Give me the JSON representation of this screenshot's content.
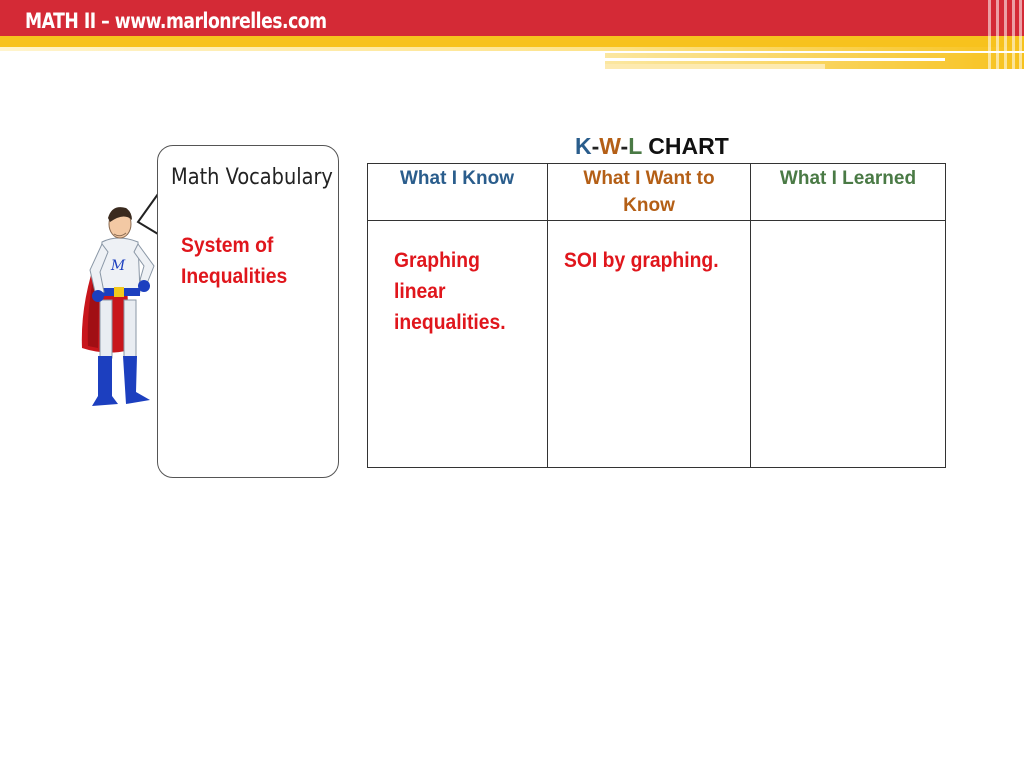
{
  "header": {
    "title": "MATH II – www.marlonrelles.com",
    "colors": {
      "red": "#d42a36",
      "yellow": "#f7c21d"
    }
  },
  "vocabulary": {
    "title": "Math Vocabulary",
    "term": "System of Inequalities"
  },
  "kwl": {
    "title_k": "K",
    "title_w": "W",
    "title_l": "L",
    "title_dash": "-",
    "title_rest": "CHART",
    "columns": [
      {
        "header": "What I Know",
        "color": "#2a5d8c",
        "content": "Graphing linear inequalities."
      },
      {
        "header": "What I Want to Know",
        "color": "#b45f16",
        "content": "SOI by graphing."
      },
      {
        "header": "What I Learned",
        "color": "#4a7a45",
        "content": ""
      }
    ],
    "content_color": "#e0161c"
  }
}
